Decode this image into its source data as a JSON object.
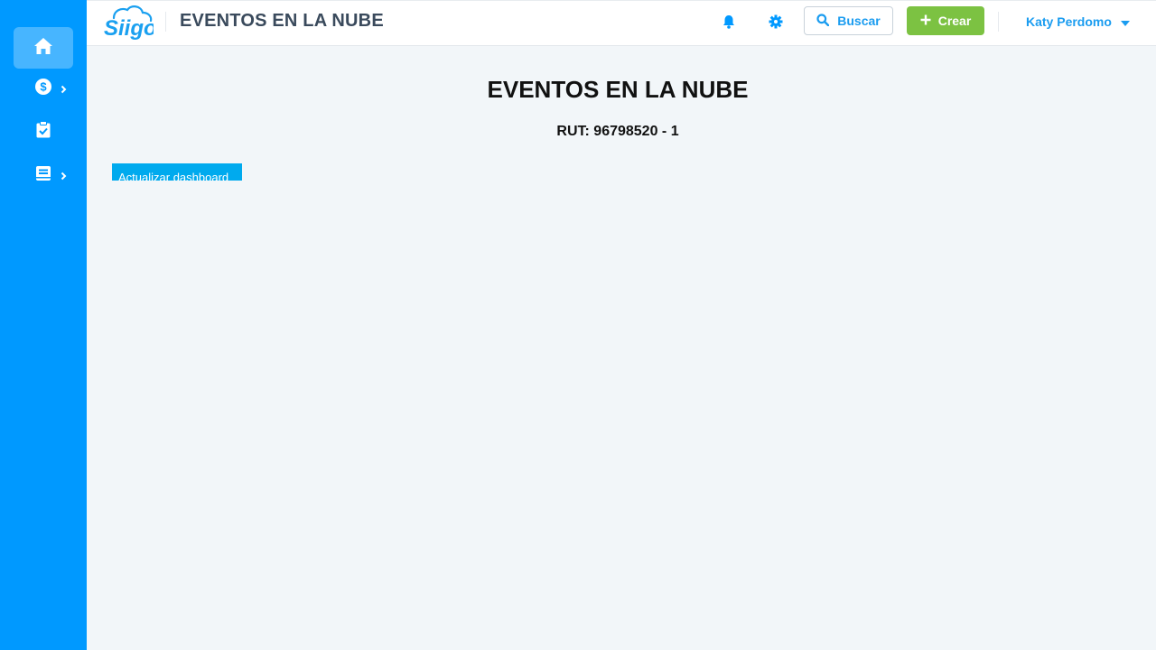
{
  "header": {
    "company_name": "EVENTOS EN LA NUBE",
    "search_label": "Buscar",
    "create_label": "Crear",
    "user_name": "Katy Perdomo"
  },
  "sidebar": {
    "items": [
      {
        "icon": "home-icon",
        "active": true
      },
      {
        "icon": "dollar-circle-icon",
        "has_submenu": true
      },
      {
        "icon": "clipboard-check-icon"
      },
      {
        "icon": "book-icon",
        "has_submenu": true
      }
    ]
  },
  "main": {
    "title": "EVENTOS EN LA NUBE",
    "rut": "RUT: 96798520 - 1",
    "refresh_button": "Actualizar dashboard"
  },
  "colors": {
    "sidebar": "#0099ff",
    "accent": "#1a9cf0",
    "create": "#7cc242",
    "background": "#f2f6f9"
  }
}
